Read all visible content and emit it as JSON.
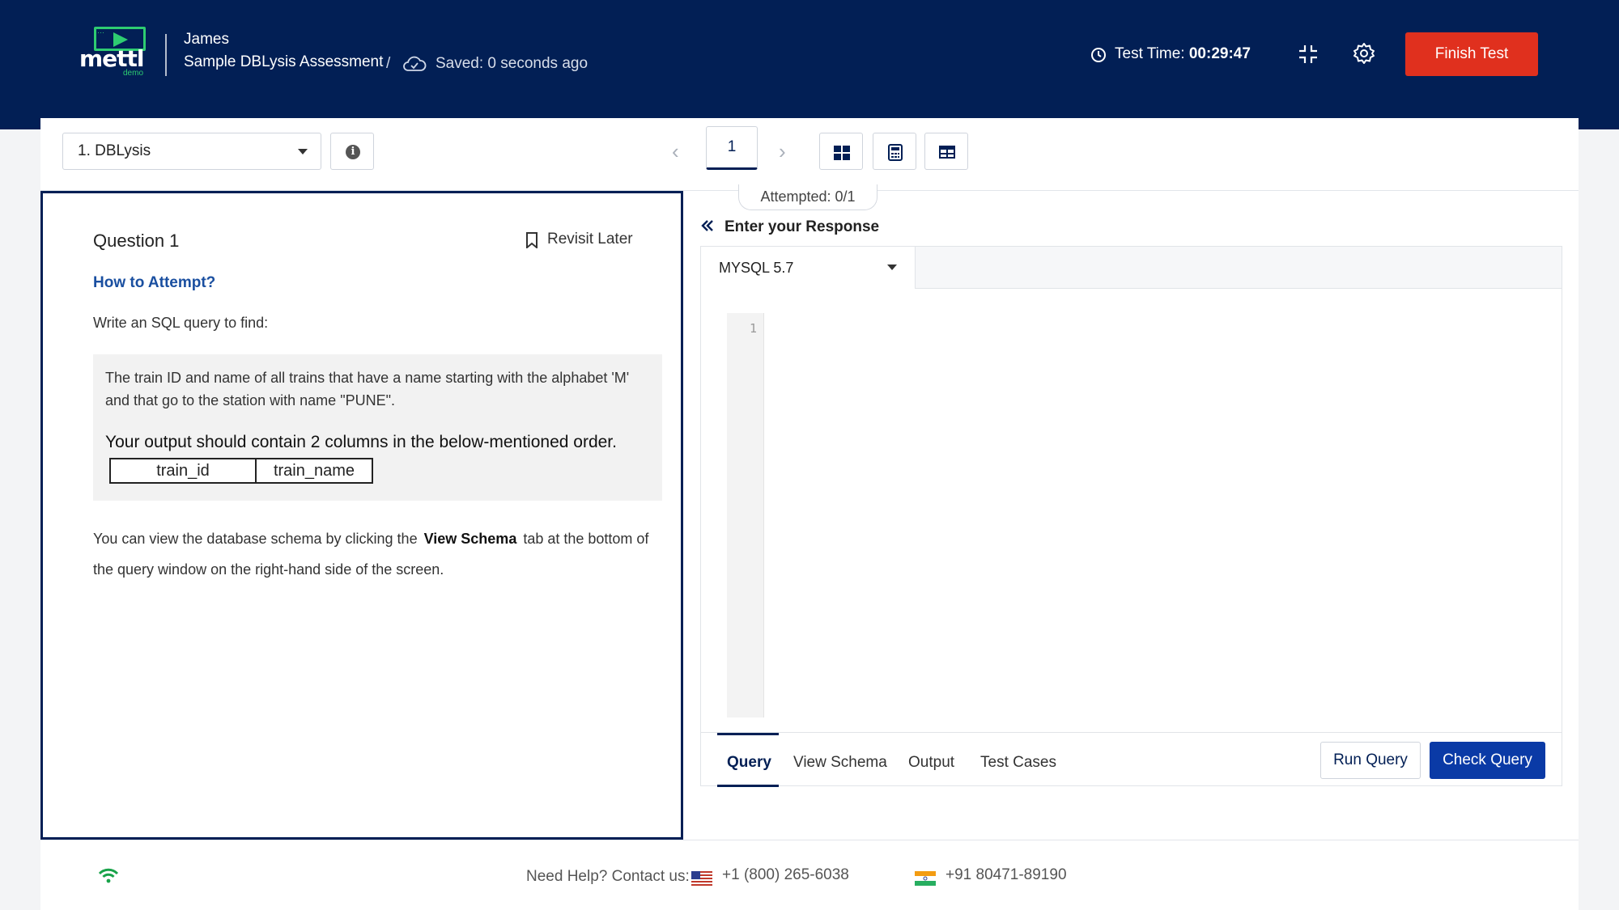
{
  "header": {
    "logo_text": "mettl",
    "logo_sub": "demo",
    "user_name": "James",
    "assessment_name": "Sample DBLysis Assessment",
    "separator": "/",
    "saved_status": "Saved: 0 seconds ago",
    "test_time_label": "Test Time:",
    "test_time_value": "00:29:47",
    "finish_label": "Finish Test",
    "finish_color": "#e0301e",
    "brand_color": "#021f55"
  },
  "toolbar": {
    "section_selected": "1. DBLysis",
    "question_number": "1",
    "attempted": "Attempted: 0/1"
  },
  "question": {
    "title": "Question 1",
    "revisit_label": "Revisit Later",
    "how_to_attempt": "How to Attempt?",
    "intro": "Write an SQL query to find:",
    "problem": "The train ID and name of all trains that have a name starting with the alphabet 'M' and that go to the station with name \"PUNE\".",
    "output_note": "Your output should contain 2 columns in the below-mentioned order.",
    "columns": [
      "train_id",
      "train_name"
    ],
    "schema_note_pre": "You can view the database schema by clicking the",
    "schema_note_bold": "View Schema",
    "schema_note_post": "tab at the bottom of the query window on the right-hand side of the screen."
  },
  "response": {
    "header": "Enter your Response",
    "db_selected": "MYSQL 5.7",
    "line_number": "1",
    "tabs": [
      "Query",
      "View Schema",
      "Output",
      "Test Cases"
    ],
    "run_label": "Run Query",
    "check_label": "Check Query"
  },
  "footer": {
    "help_label": "Need Help? Contact us:",
    "phone_us": "+1 (800) 265-6038",
    "phone_in": "+91 80471-89190"
  }
}
